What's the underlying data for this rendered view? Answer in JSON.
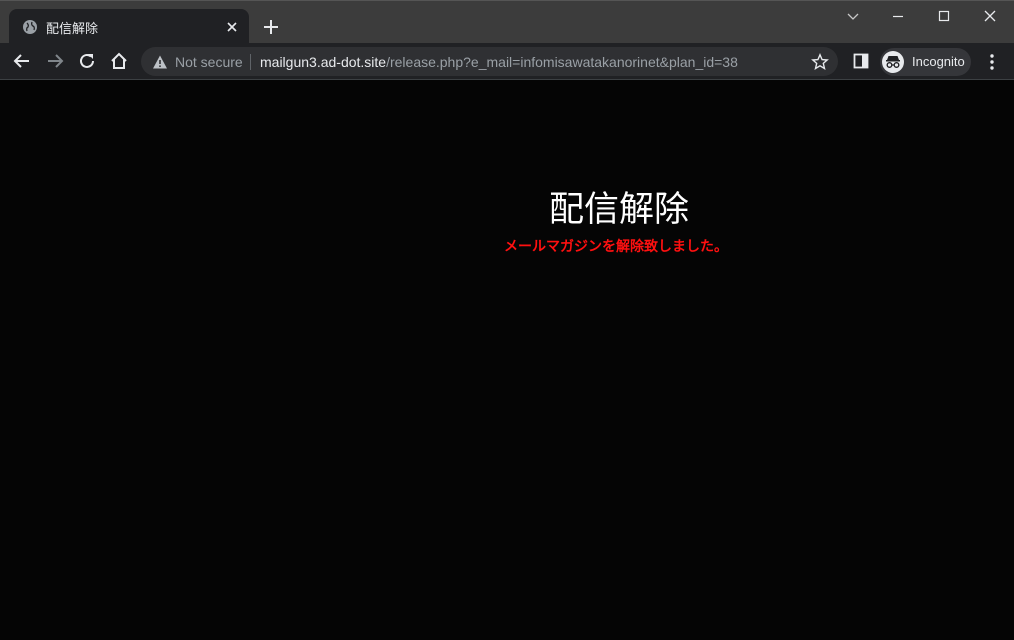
{
  "browser": {
    "tab": {
      "title": "配信解除",
      "favicon": "globe-icon"
    },
    "address_bar": {
      "security_label": "Not secure",
      "host": "mailgun3.ad-dot.site",
      "path": "/release.php?e_mail=infomisawatakanorinet&plan_id=38"
    },
    "profile": {
      "label": "Incognito"
    }
  },
  "page": {
    "title": "配信解除",
    "message": "メールマガジンを解除致しました。"
  },
  "colors": {
    "page_background": "#050505",
    "title_text": "#ffffff",
    "message_text": "#ff1010"
  }
}
